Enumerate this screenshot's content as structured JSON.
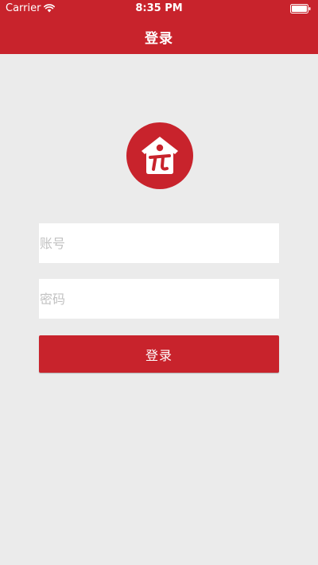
{
  "status_bar": {
    "carrier": "Carrier",
    "time": "8:35 PM",
    "wifi_icon": "wifi-icon",
    "battery_icon": "battery-icon"
  },
  "nav": {
    "title": "登录"
  },
  "logo": {
    "icon": "house-logo-icon",
    "color": "#c8232c"
  },
  "form": {
    "account_placeholder": "账号",
    "account_value": "",
    "password_placeholder": "密码",
    "password_value": "",
    "login_label": "登录"
  },
  "colors": {
    "accent": "#c8232c",
    "background": "#ebebeb"
  }
}
